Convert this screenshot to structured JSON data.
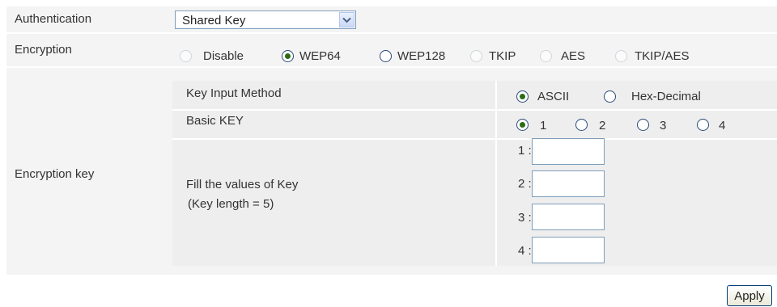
{
  "authentication": {
    "label": "Authentication",
    "selected": "Shared Key"
  },
  "encryption": {
    "label": "Encryption",
    "options": [
      {
        "label": "Disable",
        "checked": false,
        "enabled": false
      },
      {
        "label": "WEP64",
        "checked": true,
        "enabled": true
      },
      {
        "label": "WEP128",
        "checked": false,
        "enabled": true
      },
      {
        "label": "TKIP",
        "checked": false,
        "enabled": false
      },
      {
        "label": "AES",
        "checked": false,
        "enabled": false
      },
      {
        "label": "TKIP/AES",
        "checked": false,
        "enabled": false
      }
    ]
  },
  "encryption_key": {
    "label": "Encryption key",
    "input_method": {
      "label": "Key Input Method",
      "options": [
        {
          "label": "ASCII",
          "checked": true
        },
        {
          "label": "Hex-Decimal",
          "checked": false
        }
      ]
    },
    "basic_key": {
      "label": "Basic KEY",
      "options": [
        {
          "label": "1",
          "checked": true
        },
        {
          "label": "2",
          "checked": false
        },
        {
          "label": "3",
          "checked": false
        },
        {
          "label": "4",
          "checked": false
        }
      ]
    },
    "fill": {
      "line1": "Fill the values of Key",
      "line2": "(Key length = 5)"
    },
    "keys": [
      {
        "label": "1 :",
        "value": ""
      },
      {
        "label": "2 :",
        "value": ""
      },
      {
        "label": "3 :",
        "value": ""
      },
      {
        "label": "4 :",
        "value": ""
      }
    ]
  },
  "apply_label": "Apply",
  "colors": {
    "row_background": "#f4f4f4",
    "inner_background": "#eeeeee",
    "radio_dot": "#2b6c12",
    "field_border": "#7f9db9"
  }
}
